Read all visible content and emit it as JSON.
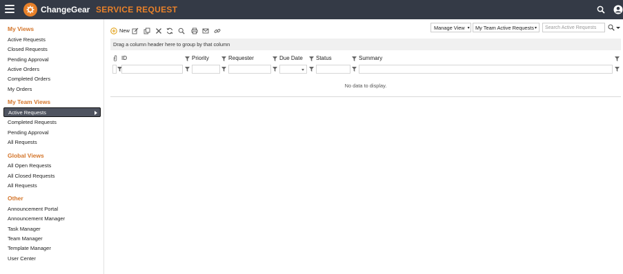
{
  "header": {
    "brand": "ChangeGear",
    "module_title": "SERVICE REQUEST",
    "accent_color": "#e8812a",
    "bar_color": "#343a46"
  },
  "sidebar": {
    "sections": [
      {
        "title": "My Views",
        "items": [
          "Active Requests",
          "Closed Requests",
          "Pending Approval",
          "Active Orders",
          "Completed Orders",
          "My Orders"
        ]
      },
      {
        "title": "My Team Views",
        "items": [
          "Active Requests",
          "Completed Requests",
          "Pending Approval",
          "All Requests"
        ]
      },
      {
        "title": "Global Views",
        "items": [
          "All Open Requests",
          "All Closed Requests",
          "All Requests"
        ]
      },
      {
        "title": "Other",
        "items": [
          "Announcement Portal",
          "Announcement Manager",
          "Task Manager",
          "Team Manager",
          "Template Manager",
          "User Center"
        ]
      }
    ]
  },
  "toolbar": {
    "new_label": "New",
    "icons": [
      "add-icon",
      "edit-icon",
      "copy-icon",
      "delete-icon",
      "refresh-icon",
      "search-icon",
      "print-icon",
      "email-icon",
      "link-icon"
    ],
    "manage_view_label": "Manage View",
    "view_select_value": "My Team Active Requests",
    "search_placeholder": "Search Active Requests"
  },
  "grid": {
    "group_panel_text": "Drag a column header here to group by that column",
    "columns": [
      "ID",
      "Priority",
      "Requester",
      "Due Date",
      "Status",
      "Summary"
    ],
    "empty_text": "No data to display."
  }
}
